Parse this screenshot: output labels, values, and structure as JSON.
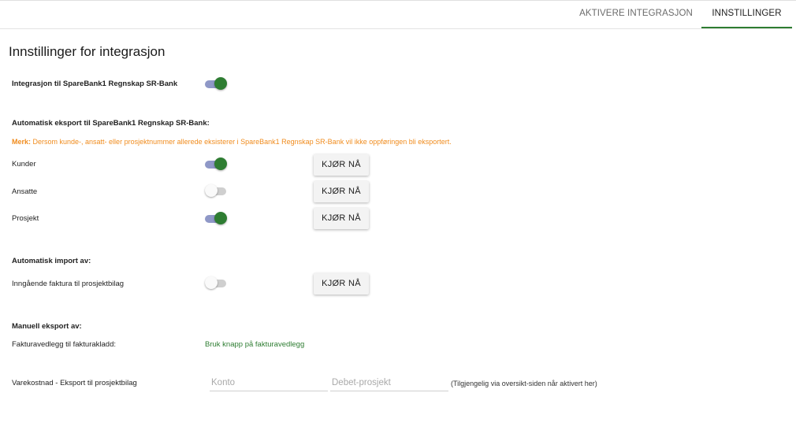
{
  "tabs": [
    {
      "label": "AKTIVERE INTEGRASJON",
      "active": false
    },
    {
      "label": "INNSTILLINGER",
      "active": true
    }
  ],
  "page_title": "Innstillinger for integrasjon",
  "integration": {
    "label": "Integrasjon til SpareBank1 Regnskap SR-Bank",
    "enabled": true
  },
  "export_section": {
    "heading": "Automatisk eksport til SpareBank1 Regnskap SR-Bank:",
    "note_prefix": "Merk:",
    "note_text": " Dersom kunde-, ansatt- eller prosjektnummer allerede eksisterer i SpareBank1 Regnskap SR-Bank vil ikke oppføringen bli eksportert.",
    "items": [
      {
        "label": "Kunder",
        "enabled": true,
        "button": "KJØR NÅ"
      },
      {
        "label": "Ansatte",
        "enabled": false,
        "button": "KJØR NÅ"
      },
      {
        "label": "Prosjekt",
        "enabled": true,
        "button": "KJØR NÅ"
      }
    ]
  },
  "import_section": {
    "heading": "Automatisk import av:",
    "items": [
      {
        "label": "Inngående faktura til prosjektbilag",
        "enabled": false,
        "button": "KJØR NÅ"
      }
    ]
  },
  "manual_section": {
    "heading": "Manuell eksport av:",
    "invoice_label": "Fakturavedlegg til fakturakladd:",
    "invoice_value": "Bruk knapp på fakturavedlegg",
    "cost_label": "Varekostnad - Eksport til prosjektbilag",
    "konto_placeholder": "Konto",
    "konto_value": "",
    "debet_placeholder": "Debet-prosjekt",
    "debet_value": "",
    "hint": "(Tilgjengelig via oversikt-siden når aktivert her)"
  },
  "colors": {
    "accent": "#2e7d32",
    "warning": "#f08c1e",
    "toggle_track_on": "#8f98c7"
  }
}
